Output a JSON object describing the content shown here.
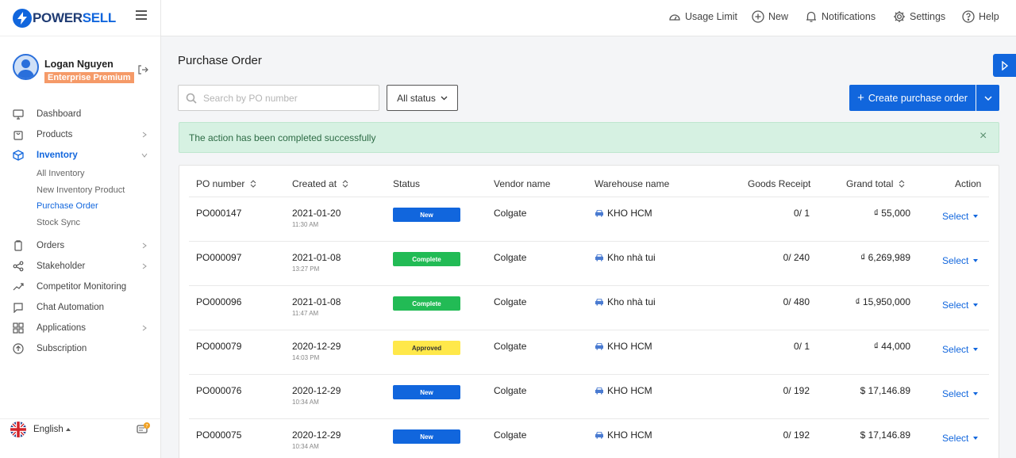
{
  "brand": {
    "name_prefix": "POWER",
    "name_suffix": "SELL"
  },
  "user": {
    "name": "Logan Nguyen",
    "plan": "Enterprise Premium"
  },
  "nav": {
    "items": [
      {
        "label": "Dashboard",
        "icon": "monitor-icon",
        "has_children": false
      },
      {
        "label": "Products",
        "icon": "bag-icon",
        "has_children": true
      },
      {
        "label": "Inventory",
        "icon": "box-icon",
        "has_children": true,
        "expanded": true
      }
    ],
    "inventory_sub": [
      "All Inventory",
      "New Inventory Product",
      "Purchase Order",
      "Stock Sync"
    ],
    "active_sub": "Purchase Order",
    "items_after": [
      {
        "label": "Orders",
        "icon": "clipboard-icon",
        "has_children": true
      },
      {
        "label": "Stakeholder",
        "icon": "share-icon",
        "has_children": true
      },
      {
        "label": "Competitor Monitoring",
        "icon": "trend-icon",
        "has_children": false
      },
      {
        "label": "Chat Automation",
        "icon": "chat-icon",
        "has_children": false
      },
      {
        "label": "Applications",
        "icon": "grid-icon",
        "has_children": true
      },
      {
        "label": "Subscription",
        "icon": "upload-circle-icon",
        "has_children": false
      }
    ]
  },
  "footer": {
    "language": "English",
    "chat_badge": "?"
  },
  "topbar": {
    "usage_limit": "Usage Limit",
    "new": "New",
    "notifications": "Notifications",
    "settings": "Settings",
    "help": "Help"
  },
  "page": {
    "title": "Purchase Order",
    "search_placeholder": "Search by PO number",
    "status_filter": "All status",
    "create_button": "Create purchase order",
    "alert": "The action has been completed successfully"
  },
  "table": {
    "columns": {
      "po_number": "PO number",
      "created_at": "Created at",
      "status": "Status",
      "vendor": "Vendor name",
      "warehouse": "Warehouse name",
      "goods_receipt": "Goods Receipt",
      "grand_total": "Grand total",
      "action": "Action"
    },
    "rows": [
      {
        "po": "PO000147",
        "date": "2021-01-20",
        "time": "11:30 AM",
        "status": "New",
        "vendor": "Colgate",
        "warehouse": "KHO HCM",
        "receipt": "0/ 1",
        "total": "₫ 55,000",
        "action": "Select"
      },
      {
        "po": "PO000097",
        "date": "2021-01-08",
        "time": "13:27 PM",
        "status": "Complete",
        "vendor": "Colgate",
        "warehouse": "Kho nhà tui",
        "receipt": "0/ 240",
        "total": "₫ 6,269,989",
        "action": "Select"
      },
      {
        "po": "PO000096",
        "date": "2021-01-08",
        "time": "11:47 AM",
        "status": "Complete",
        "vendor": "Colgate",
        "warehouse": "Kho nhà tui",
        "receipt": "0/ 480",
        "total": "₫ 15,950,000",
        "action": "Select"
      },
      {
        "po": "PO000079",
        "date": "2020-12-29",
        "time": "14:03 PM",
        "status": "Approved",
        "vendor": "Colgate",
        "warehouse": "KHO HCM",
        "receipt": "0/ 1",
        "total": "₫ 44,000",
        "action": "Select"
      },
      {
        "po": "PO000076",
        "date": "2020-12-29",
        "time": "10:34 AM",
        "status": "New",
        "vendor": "Colgate",
        "warehouse": "KHO HCM",
        "receipt": "0/ 192",
        "total": "$ 17,146.89",
        "action": "Select"
      },
      {
        "po": "PO000075",
        "date": "2020-12-29",
        "time": "10:34 AM",
        "status": "New",
        "vendor": "Colgate",
        "warehouse": "KHO HCM",
        "receipt": "0/ 192",
        "total": "$ 17,146.89",
        "action": "Select"
      }
    ]
  },
  "status_colors": {
    "New": "#1166dd",
    "Complete": "#22bb55",
    "Approved": "#ffe84a"
  },
  "accent": "#1166dd"
}
